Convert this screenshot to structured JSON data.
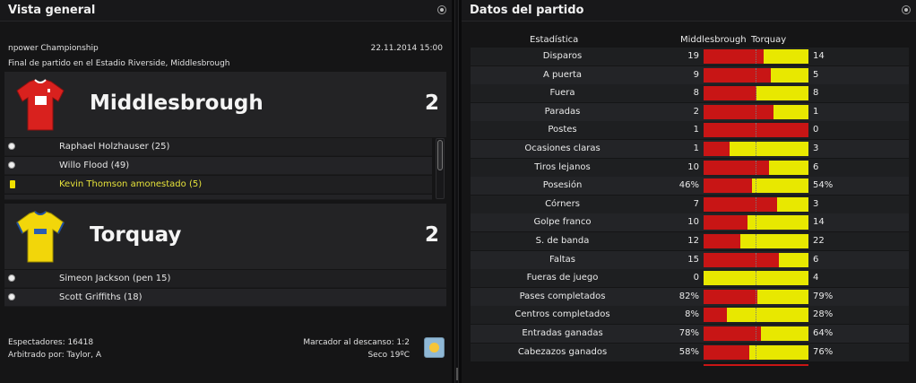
{
  "overview": {
    "title": "Vista general",
    "competition": "npower Championship",
    "datetime": "22.11.2014 15:00",
    "venue": "Final de partido en el Estadio Riverside, Middlesbrough",
    "home": {
      "name": "Middlesbrough",
      "score": "2",
      "events": [
        {
          "type": "goal",
          "text": "Raphael Holzhauser (25)"
        },
        {
          "type": "goal",
          "text": "Willo Flood (49)"
        },
        {
          "type": "yellow-card",
          "text": "Kevin Thomson amonestado (5)"
        }
      ]
    },
    "away": {
      "name": "Torquay",
      "score": "2",
      "events": [
        {
          "type": "goal",
          "text": "Simeon Jackson (pen 15)"
        },
        {
          "type": "goal",
          "text": "Scott Griffiths (18)"
        }
      ]
    },
    "attendance": "Espectadores: 16418",
    "referee": "Arbitrado por: Taylor, A",
    "halftime": "Marcador al descanso: 1:2",
    "weather": "Seco 19ºC",
    "weather_icon": "sunny-weather-icon"
  },
  "stats": {
    "title": "Datos del partido",
    "header": {
      "stat": "Estadística",
      "home": "Middlesbrough",
      "away": "Torquay"
    },
    "colors": {
      "home": "#c81515",
      "away": "#e8e800"
    },
    "rows": [
      {
        "name": "Disparos",
        "home": "19",
        "away": "14",
        "home_share": 0.576
      },
      {
        "name": "A puerta",
        "home": "9",
        "away": "5",
        "home_share": 0.643
      },
      {
        "name": "Fuera",
        "home": "8",
        "away": "8",
        "home_share": 0.5
      },
      {
        "name": "Paradas",
        "home": "2",
        "away": "1",
        "home_share": 0.667
      },
      {
        "name": "Postes",
        "home": "1",
        "away": "0",
        "home_share": 1.0
      },
      {
        "name": "Ocasiones claras",
        "home": "1",
        "away": "3",
        "home_share": 0.25
      },
      {
        "name": "Tiros lejanos",
        "home": "10",
        "away": "6",
        "home_share": 0.625
      },
      {
        "name": "Posesión",
        "home": "46%",
        "away": "54%",
        "home_share": 0.46
      },
      {
        "name": "Córners",
        "home": "7",
        "away": "3",
        "home_share": 0.7
      },
      {
        "name": "Golpe franco",
        "home": "10",
        "away": "14",
        "home_share": 0.417
      },
      {
        "name": "S. de banda",
        "home": "12",
        "away": "22",
        "home_share": 0.353
      },
      {
        "name": "Faltas",
        "home": "15",
        "away": "6",
        "home_share": 0.714
      },
      {
        "name": "Fueras de juego",
        "home": "0",
        "away": "4",
        "home_share": 0.0
      },
      {
        "name": "Pases completados",
        "home": "82%",
        "away": "79%",
        "home_share": 0.509
      },
      {
        "name": "Centros completados",
        "home": "8%",
        "away": "28%",
        "home_share": 0.222
      },
      {
        "name": "Entradas ganadas",
        "home": "78%",
        "away": "64%",
        "home_share": 0.549
      },
      {
        "name": "Cabezazos ganados",
        "home": "58%",
        "away": "76%",
        "home_share": 0.433
      }
    ]
  }
}
